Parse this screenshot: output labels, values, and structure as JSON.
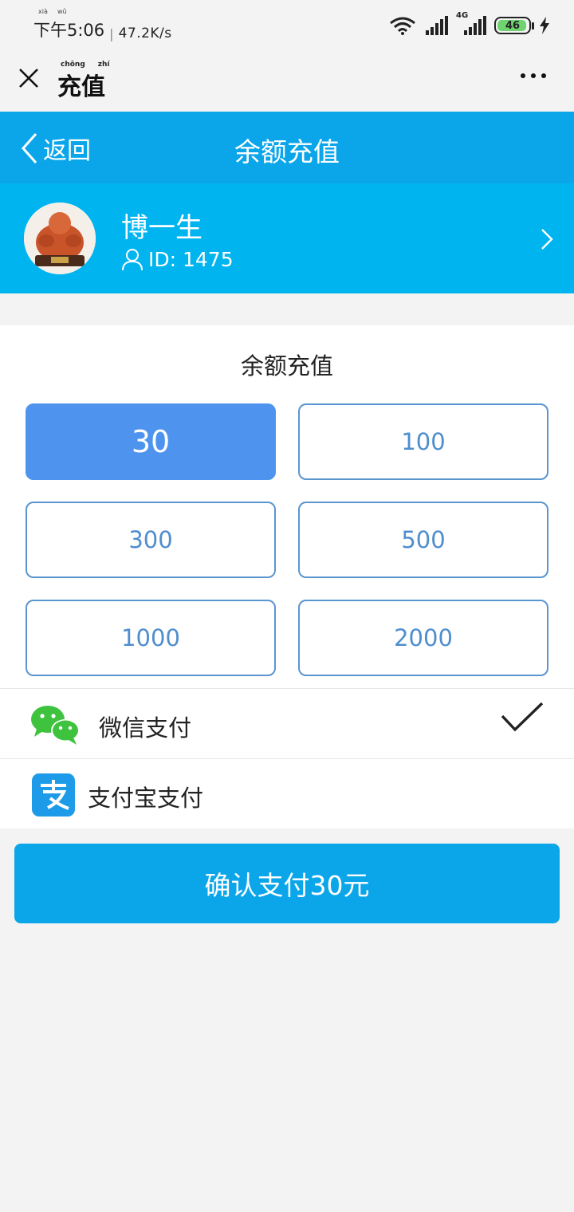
{
  "status_bar": {
    "ruby_xia": "xià",
    "ruby_wu": "wǔ",
    "time": "下午5:06",
    "separator": "|",
    "speed": "47.2K/s",
    "network_label": "4G",
    "battery": "46"
  },
  "title_bar": {
    "ruby": [
      "chōng",
      "zhí"
    ],
    "title": "充值"
  },
  "nav": {
    "back_label": "返回",
    "title": "余额充值"
  },
  "profile": {
    "name": "博一生",
    "id_text": "ID: 1475"
  },
  "recharge": {
    "title": "余额充值",
    "amounts": [
      "30",
      "100",
      "300",
      "500",
      "1000",
      "2000"
    ],
    "selected_amount": "30"
  },
  "payment": {
    "wechat_label": "微信支付",
    "alipay_label": "支付宝支付",
    "selected_method": "wechat"
  },
  "confirm": {
    "label": "确认支付30元"
  },
  "colors": {
    "header_blue": "#0ba6ea",
    "profile_blue": "#00b4f0",
    "selected_amount": "#4e94ee",
    "amount_border": "#5a95cf",
    "wechat_green": "#3fc33f",
    "alipay_blue": "#1e9be8"
  }
}
